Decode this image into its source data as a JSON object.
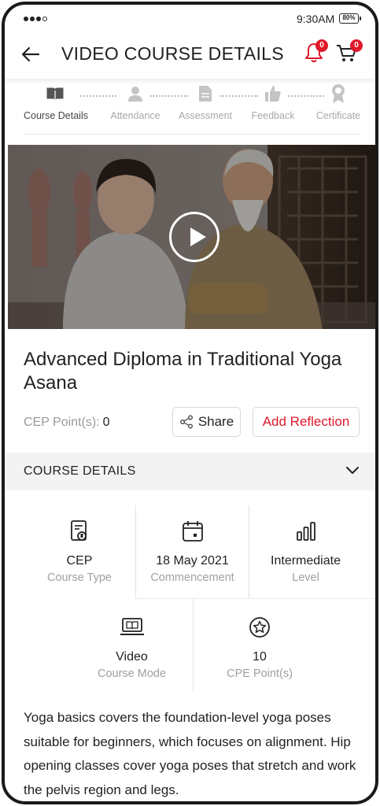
{
  "status_bar": {
    "time": "9:30AM",
    "battery": "80%"
  },
  "header": {
    "title": "VIDEO COURSE DETAILS",
    "notification_count": "0",
    "cart_count": "0"
  },
  "stepper": {
    "steps": [
      {
        "label": "Course Details",
        "icon": "book-icon"
      },
      {
        "label": "Attendance",
        "icon": "person-icon"
      },
      {
        "label": "Assessment",
        "icon": "document-icon"
      },
      {
        "label": "Feedback",
        "icon": "thumbs-up-icon"
      },
      {
        "label": "Certificate",
        "icon": "award-icon"
      }
    ]
  },
  "course": {
    "title": "Advanced Diploma in Traditional Yoga Asana",
    "cep_label": "CEP Point(s):",
    "cep_value": "0",
    "share_label": "Share",
    "reflection_label": "Add Reflection"
  },
  "details": {
    "section_label": "COURSE DETAILS",
    "items": [
      {
        "value": "CEP",
        "key": "Course Type",
        "icon": "course-type-icon"
      },
      {
        "value": "18 May 2021",
        "key": "Commencement",
        "icon": "calendar-icon"
      },
      {
        "value": "Intermediate",
        "key": "Level",
        "icon": "level-bars-icon"
      },
      {
        "value": "Video",
        "key": "Course Mode",
        "icon": "laptop-book-icon"
      },
      {
        "value": "10",
        "key": "CPE Point(s)",
        "icon": "star-badge-icon"
      }
    ]
  },
  "description": "Yoga basics covers the foundation-level yoga poses suitable for beginners, which focuses on alignment. Hip opening classes cover yoga poses that stretch and work the pelvis region and legs.",
  "colors": {
    "accent": "#e0192b",
    "muted": "#a0a0a0",
    "section_bg": "#f3f3f3"
  }
}
